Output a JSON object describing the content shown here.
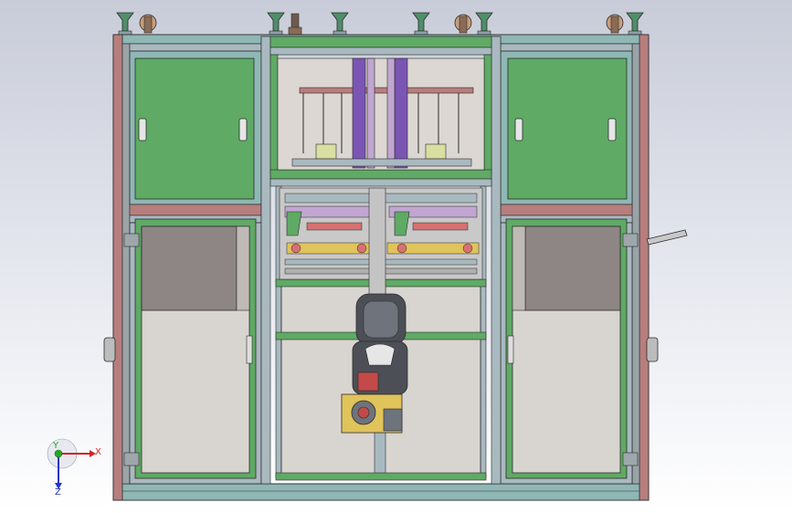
{
  "viewport": {
    "background_top": "#c8ccd8",
    "background_bottom": "#ffffff"
  },
  "colors": {
    "frame_outer": "#b77e7e",
    "frame_inner": "#8fb7b5",
    "panel_green": "#5faa64",
    "panel_green_dark": "#3f8a48",
    "window_gray": "#8e8585",
    "window_light": "#d8d5d0",
    "rail_steel": "#a9b9c0",
    "purple_column": "#7b55b3",
    "robot_dark": "#4c4f56",
    "robot_mid": "#6f737b",
    "robot_base": "#e0c35a",
    "accent_red": "#c44a4a",
    "outline": "#2b2b2b"
  },
  "triad": {
    "x_label": "X",
    "y_label": "Y",
    "z_label": "Z",
    "x_color": "#d02525",
    "y_color": "#25a825",
    "z_color": "#2535c8"
  },
  "icons": {
    "triad": "coordinate-triad-icon",
    "caster": "leveling-foot-icon"
  }
}
